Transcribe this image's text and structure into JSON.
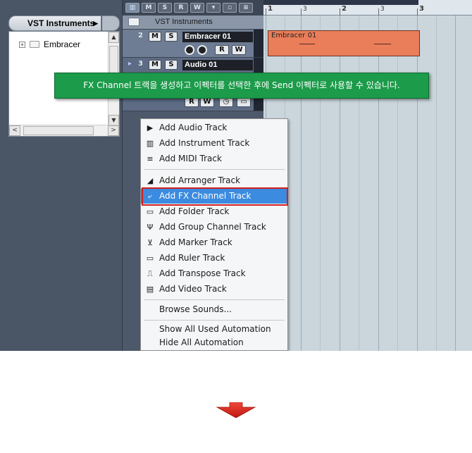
{
  "inspector": {
    "header_label": "VST Instruments",
    "tree_item": "Embracer"
  },
  "tracks": {
    "folder_name": "VST Instruments",
    "instrument": {
      "number": "2",
      "mute": "M",
      "solo": "S",
      "name": "Embracer 01",
      "read": "R",
      "write": "W"
    },
    "audio": {
      "number": "3",
      "mute": "M",
      "solo": "S",
      "name": "Audio 01",
      "read": "R",
      "write": "W"
    }
  },
  "toolbar": {
    "btn1": "M",
    "btn2": "S",
    "btn3": "R",
    "btn4": "W"
  },
  "ruler": {
    "marks": [
      "1",
      "3",
      "2",
      "3",
      "3"
    ]
  },
  "event": {
    "name": "Embracer 01"
  },
  "tooltip": {
    "text": "FX Channel 트랙을 생성하고 이펙터를 선택한 후에 Send 이펙터로 사용할 수 있습니다."
  },
  "menu": {
    "add_audio": "Add Audio Track",
    "add_instrument": "Add Instrument Track",
    "add_midi": "Add MIDI Track",
    "add_arranger": "Add Arranger Track",
    "add_fx": "Add FX Channel Track",
    "add_folder": "Add Folder Track",
    "add_group": "Add Group Channel Track",
    "add_marker": "Add Marker Track",
    "add_ruler": "Add Ruler Track",
    "add_transpose": "Add Transpose Track",
    "add_video": "Add Video Track",
    "browse_sounds": "Browse Sounds...",
    "show_all_automation": "Show All Used Automation",
    "hide_all_automation": "Hide All Automation"
  },
  "colors": {
    "tooltip_bg": "#1c9b4a",
    "highlight": "#3b8be0",
    "highlight_border": "#d11f1f",
    "event": "#ea7e5a",
    "arrow": "#e3201b"
  }
}
